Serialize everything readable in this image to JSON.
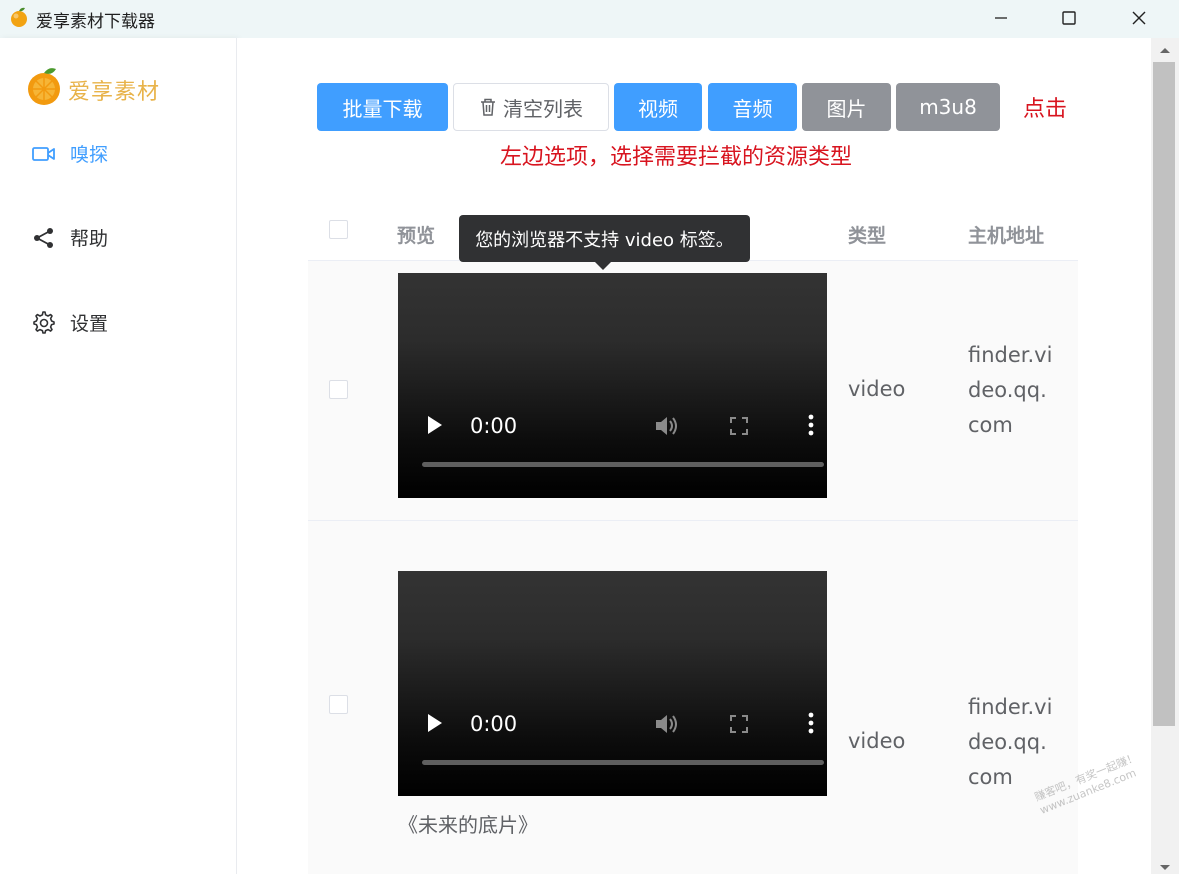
{
  "window": {
    "title": "爱享素材下载器"
  },
  "sidebar": {
    "brand": "爱享素材",
    "items": [
      {
        "label": "嗅探",
        "icon": "video-camera-icon",
        "active": true
      },
      {
        "label": "帮助",
        "icon": "share-icon",
        "active": false
      },
      {
        "label": "设置",
        "icon": "gear-icon",
        "active": false
      }
    ]
  },
  "toolbar": {
    "batch_download": "批量下载",
    "clear_list": "清空列表",
    "filters": [
      {
        "label": "视频",
        "selected": true
      },
      {
        "label": "音频",
        "selected": true
      },
      {
        "label": "图片",
        "selected": false
      },
      {
        "label": "m3u8",
        "selected": false
      }
    ]
  },
  "annotation": {
    "line1": "点击",
    "line2": "左边选项，选择需要拦截的资源类型"
  },
  "table": {
    "headers": {
      "preview": "预览",
      "type": "类型",
      "host": "主机地址"
    },
    "rows": [
      {
        "time": "0:00",
        "type": "video",
        "host": "finder.video.qq.com",
        "caption": ""
      },
      {
        "time": "0:00",
        "type": "video",
        "host": "finder.video.qq.com",
        "caption": "《未来的底片》"
      }
    ]
  },
  "tooltip": {
    "text": "您的浏览器不支持 video 标签。"
  },
  "watermark": "赚客吧，有奖一起赚！ www.zuanke8.com",
  "colors": {
    "primary": "#409eff",
    "inactive": "#909399",
    "brand": "#e8b34a",
    "annotation": "#d8141f"
  }
}
